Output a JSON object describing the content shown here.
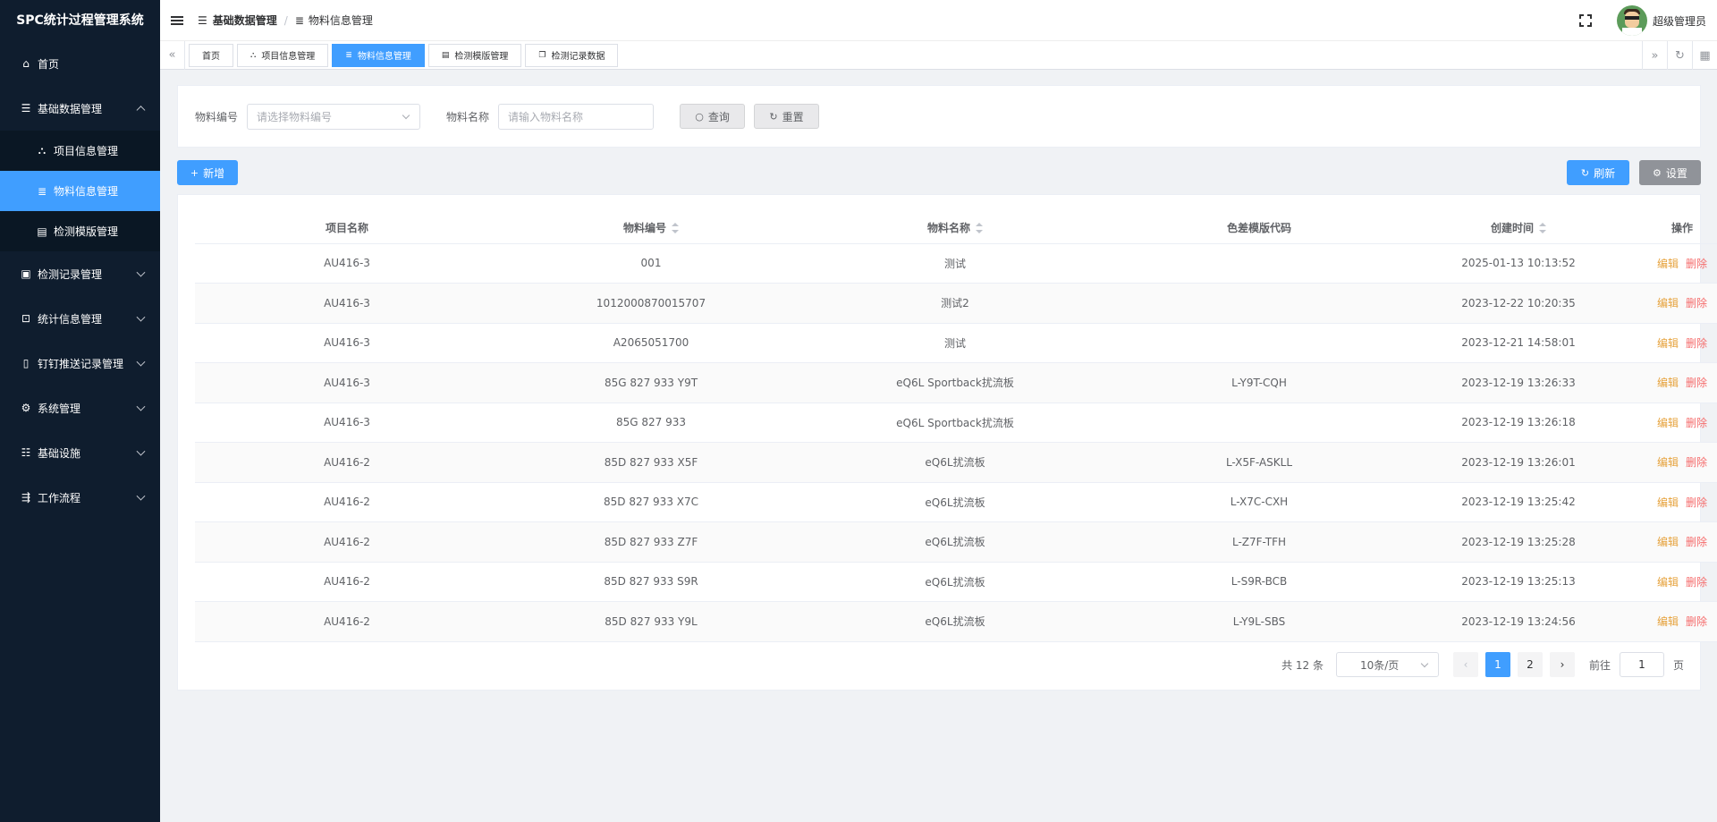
{
  "app": {
    "title": "SPC统计过程管理系统"
  },
  "sidebar": {
    "items": [
      {
        "label": "首页",
        "icon": "home-icon"
      },
      {
        "label": "基础数据管理",
        "icon": "list-icon",
        "expanded": true,
        "children": [
          {
            "label": "项目信息管理",
            "icon": "nodes-icon"
          },
          {
            "label": "物料信息管理",
            "icon": "database-icon",
            "active": true
          },
          {
            "label": "检测模版管理",
            "icon": "document-icon"
          }
        ]
      },
      {
        "label": "检测记录管理",
        "icon": "clipboard-icon"
      },
      {
        "label": "统计信息管理",
        "icon": "cart-icon"
      },
      {
        "label": "钉钉推送记录管理",
        "icon": "file-icon"
      },
      {
        "label": "系统管理",
        "icon": "gear-icon"
      },
      {
        "label": "基础设施",
        "icon": "list-icon"
      },
      {
        "label": "工作流程",
        "icon": "flow-icon"
      }
    ]
  },
  "header": {
    "breadcrumb": [
      "基础数据管理",
      "物料信息管理"
    ],
    "user": "超级管理员"
  },
  "tags": [
    "首页",
    "项目信息管理",
    "物料信息管理",
    "检测模版管理",
    "检测记录数据"
  ],
  "search": {
    "code_label": "物料编号",
    "code_placeholder": "请选择物料编号",
    "name_label": "物料名称",
    "name_placeholder": "请输入物料名称",
    "query": "查询",
    "reset": "重置"
  },
  "toolbar": {
    "add": "新增",
    "refresh": "刷新",
    "settings": "设置"
  },
  "table": {
    "columns": [
      "项目名称",
      "物料编号",
      "物料名称",
      "色差模版代码",
      "创建时间",
      "操作"
    ],
    "rows": [
      [
        "AU416-3",
        "001",
        "测试",
        "",
        "2025-01-13 10:13:52"
      ],
      [
        "AU416-3",
        "1012000870015707",
        "测试2",
        "",
        "2023-12-22 10:20:35"
      ],
      [
        "AU416-3",
        "A2065051700",
        "测试",
        "",
        "2023-12-21 14:58:01"
      ],
      [
        "AU416-3",
        "85G 827 933 Y9T",
        "eQ6L Sportback扰流板",
        "L-Y9T-CQH",
        "2023-12-19 13:26:33"
      ],
      [
        "AU416-3",
        "85G 827 933",
        "eQ6L Sportback扰流板",
        "",
        "2023-12-19 13:26:18"
      ],
      [
        "AU416-2",
        "85D 827 933 X5F",
        "eQ6L扰流板",
        "L-X5F-ASKLL",
        "2023-12-19 13:26:01"
      ],
      [
        "AU416-2",
        "85D 827 933 X7C",
        "eQ6L扰流板",
        "L-X7C-CXH",
        "2023-12-19 13:25:42"
      ],
      [
        "AU416-2",
        "85D 827 933 Z7F",
        "eQ6L扰流板",
        "L-Z7F-TFH",
        "2023-12-19 13:25:28"
      ],
      [
        "AU416-2",
        "85D 827 933 S9R",
        "eQ6L扰流板",
        "L-S9R-BCB",
        "2023-12-19 13:25:13"
      ],
      [
        "AU416-2",
        "85D 827 933 Y9L",
        "eQ6L扰流板",
        "L-Y9L-SBS",
        "2023-12-19 13:24:56"
      ]
    ],
    "edit": "编辑",
    "delete": "删除"
  },
  "pagination": {
    "total": "共 12 条",
    "page_size": "10条/页",
    "pages": [
      "1",
      "2"
    ],
    "current": 1,
    "goto_label": "前往",
    "goto_value": "1",
    "page_unit": "页"
  },
  "colors": {
    "primary": "#409eff",
    "sidebar_bg": "#0f1d2e",
    "edit": "#e6a23c",
    "delete": "#f56c6c"
  }
}
